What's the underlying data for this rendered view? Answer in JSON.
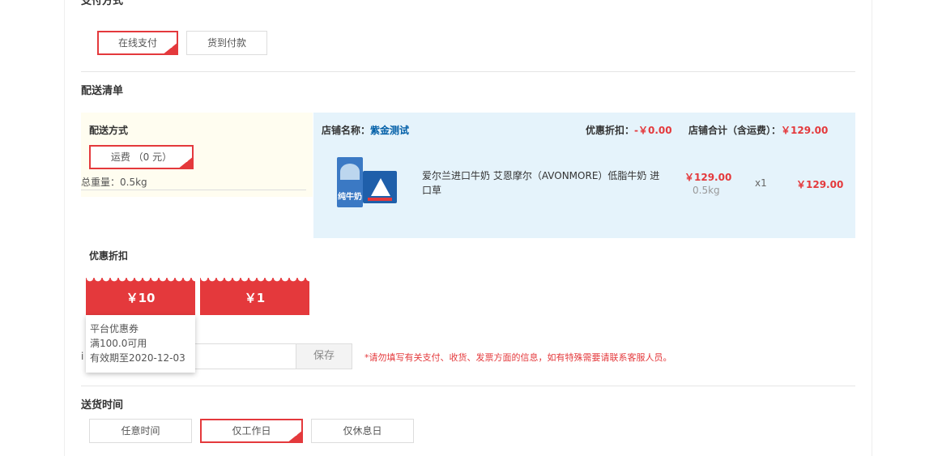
{
  "payment": {
    "title": "支付方式",
    "options": [
      {
        "label": "在线支付",
        "selected": true
      },
      {
        "label": "货到付款",
        "selected": false
      }
    ]
  },
  "delivery_list": {
    "title": "配送清单",
    "method_label": "配送方式",
    "freight_option": "运费 （0 元）",
    "total_weight": "总重量：0.5kg"
  },
  "store": {
    "name_label": "店铺名称：",
    "name": "紫金测试",
    "discount_label": "优惠折扣：",
    "discount": "-￥0.00",
    "total_label": "店铺合计（含运费）：",
    "total": "￥129.00"
  },
  "product": {
    "name": "爱尔兰进口牛奶 艾恩摩尔（AVONMORE）低脂牛奶 进口草",
    "price": "￥129.00",
    "weight": "0.5kg",
    "qty": "x1",
    "subtotal": "￥129.00",
    "pack_text": "纯牛奶"
  },
  "discount_section": {
    "title": "优惠折扣",
    "coupons": [
      {
        "value": "￥10"
      },
      {
        "value": "￥1"
      }
    ],
    "tooltip": {
      "type": "平台优惠券",
      "condition": "满100.0可用",
      "expiry": "有效期至2020-12-03"
    }
  },
  "remark": {
    "label_partial": "i",
    "save_label": "保存",
    "warning": "*请勿填写有关支付、收货、发票方面的信息，如有特殊需要请联系客服人员。"
  },
  "delivery_time": {
    "title": "送货时间",
    "options": [
      {
        "label": "任意时间",
        "selected": false
      },
      {
        "label": "仅工作日",
        "selected": true
      },
      {
        "label": "仅休息日",
        "selected": false
      }
    ]
  },
  "colors": {
    "accent": "#e4393c",
    "store_bg": "#e5f3fb",
    "ship_bg": "#fffdf0",
    "store_name": "#005ea7"
  }
}
